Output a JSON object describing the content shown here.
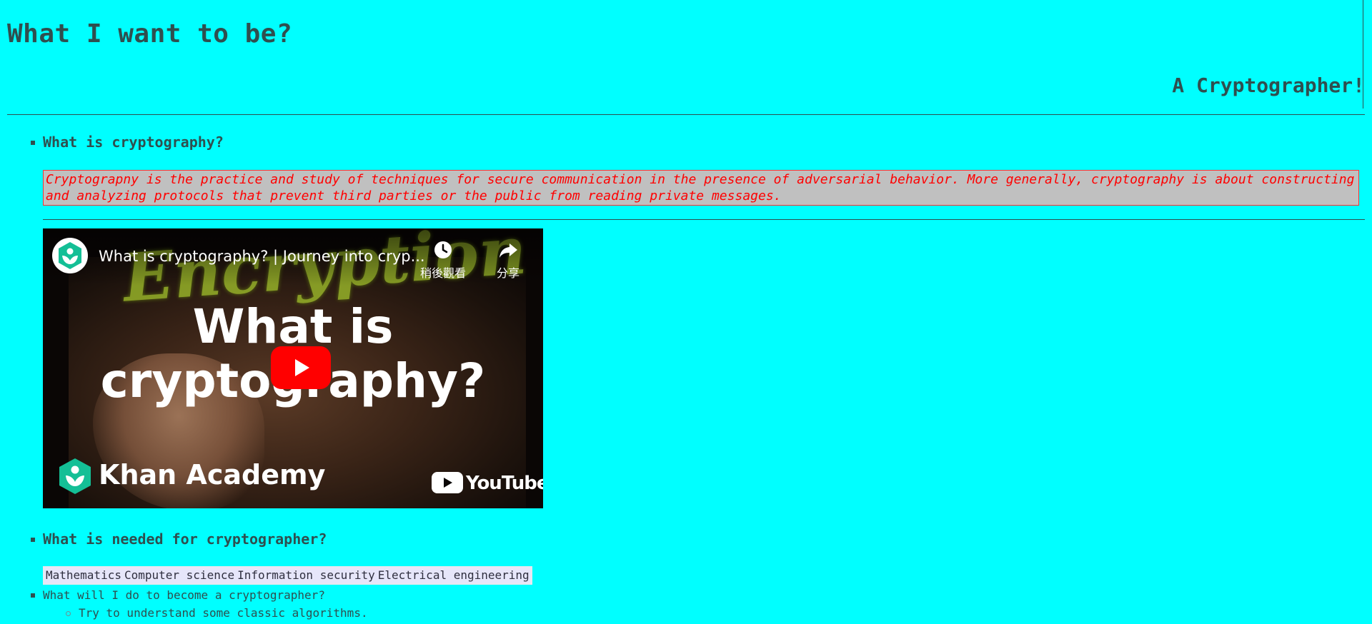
{
  "page": {
    "title": "What I want to be?",
    "subtitle": "A Cryptographer!"
  },
  "sections": {
    "what_is": {
      "heading": "What is cryptography?",
      "definition": "Cryptograpny is the practice and study of techniques for secure communication in the presence of adversarial behavior. More generally, cryptography is about constructing and analyzing protocols that prevent third parties or the public from reading private messages."
    },
    "needed": {
      "heading": "What is needed for cryptographer?",
      "skills": [
        "Mathematics",
        "Computer science",
        "Information security",
        "Electrical engineering"
      ]
    },
    "todo": {
      "heading": "What will I do to become a cryptographer?",
      "items": [
        "Try to understand some classic algorithms."
      ]
    }
  },
  "video": {
    "title": "What is cryptography? | Journey into cryp...",
    "watch_later_label": "稍後觀看",
    "share_label": "分享",
    "thumbnail_title_line1": "What is",
    "thumbnail_title_line2": "cryptography?",
    "thumbnail_neon_text": "Encryption",
    "channel_name": "Khan Academy",
    "platform_name": "YouTube",
    "colors": {
      "play_button": "#ff0000",
      "khan_green": "#14bf96"
    },
    "icons": [
      "khan-academy-logo-icon",
      "clock-icon",
      "share-arrow-icon",
      "play-icon",
      "youtube-logo-icon"
    ]
  },
  "theme": {
    "background": "#00ffff",
    "text": "#2f4f4f",
    "definition_text": "#ff0000",
    "definition_background": "#c0c0c0",
    "skill_background": "#e6e6fa"
  }
}
